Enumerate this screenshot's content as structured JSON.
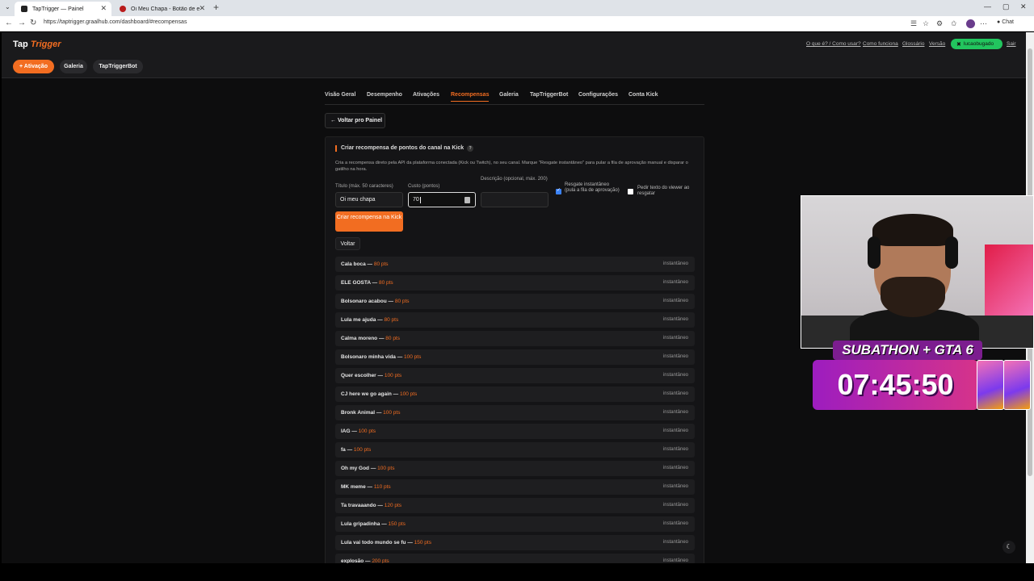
{
  "browser": {
    "tabs": [
      {
        "title": "TapTrigger — Painel",
        "active": true,
        "favicon_color": "#222222"
      },
      {
        "title": "Oi Meu Chapa - Botão de efeito s...",
        "active": false,
        "favicon_color": "#b91c1c"
      }
    ],
    "url": "https://taptrigger.graalhub.com/dashboard/#recompensas",
    "chat_label": "Chat"
  },
  "app": {
    "logo_main": "Tap",
    "logo_accent": "Trigger",
    "top_links": [
      "O que é? / Como usar?",
      "Como funciona",
      "Glossário",
      "Versão"
    ],
    "user_name": "lucaobugado",
    "logout": "Sair",
    "nav": {
      "activation": "+ Ativação",
      "gallery": "Galeria",
      "bot": "TapTriggerBot"
    },
    "subtabs": [
      "Visão Geral",
      "Desempenho",
      "Ativações",
      "Recompensas",
      "Galeria",
      "TapTriggerBot",
      "Configurações",
      "Conta Kick"
    ],
    "active_subtab": "Recompensas",
    "back_button": "← Voltar pro Painel"
  },
  "form": {
    "title": "Criar recompensa de pontos do canal na Kick",
    "help": "?",
    "description": "Cria a recompensa direto pela API da plataforma conectada (Kick ou Twitch), no seu canal. Marque \"Resgate instantâneo\" para pular a fila de aprovação manual e disparar o gatilho na hora.",
    "title_label": "Título (máx. 50 caracteres)",
    "title_value": "Oi meu chapa",
    "cost_label": "Custo (pontos)",
    "cost_value": "70",
    "desc_label": "Descrição (opcional, máx. 200)",
    "desc_value": "",
    "instant_label": "Resgate instantâneo (pula a fila de aprovação)",
    "instant_checked": true,
    "ask_text_label": "Pedir texto do viewer ao resgatar",
    "ask_text_checked": false,
    "create_button": "Criar recompensa na Kick",
    "back_button": "Voltar"
  },
  "rewards": [
    {
      "name": "Cala boca",
      "pts": "80 pts",
      "kind": "instantâneo"
    },
    {
      "name": "ELE GOSTA",
      "pts": "80 pts",
      "kind": "instantâneo"
    },
    {
      "name": "Bolsonaro acabou",
      "pts": "80 pts",
      "kind": "instantâneo"
    },
    {
      "name": "Lula me ajuda",
      "pts": "80 pts",
      "kind": "instantâneo"
    },
    {
      "name": "Calma moreno",
      "pts": "80 pts",
      "kind": "instantâneo"
    },
    {
      "name": "Bolsonaro minha vida",
      "pts": "100 pts",
      "kind": "instantâneo"
    },
    {
      "name": "Quer escolher",
      "pts": "100 pts",
      "kind": "instantâneo"
    },
    {
      "name": "CJ here we go again",
      "pts": "100 pts",
      "kind": "instantâneo"
    },
    {
      "name": "Bronk Animal",
      "pts": "100 pts",
      "kind": "instantâneo"
    },
    {
      "name": "IAG",
      "pts": "100 pts",
      "kind": "instantâneo"
    },
    {
      "name": "fa",
      "pts": "100 pts",
      "kind": "instantâneo"
    },
    {
      "name": "Oh my God",
      "pts": "100 pts",
      "kind": "instantâneo"
    },
    {
      "name": "MK meme",
      "pts": "110 pts",
      "kind": "instantâneo"
    },
    {
      "name": "Ta travaaando",
      "pts": "120 pts",
      "kind": "instantâneo"
    },
    {
      "name": "Lula gripadinha",
      "pts": "150 pts",
      "kind": "instantâneo"
    },
    {
      "name": "Lula vai todo mundo se fu",
      "pts": "150 pts",
      "kind": "instantâneo"
    },
    {
      "name": "explosão",
      "pts": "200 pts",
      "kind": "instantâneo"
    }
  ],
  "overlay": {
    "title": "SUBATHON + GTA 6",
    "timer": "07:45:50"
  },
  "colors": {
    "accent": "#f26d21",
    "user_pill": "#22c55e",
    "page_bg": "#0d0d0e"
  }
}
